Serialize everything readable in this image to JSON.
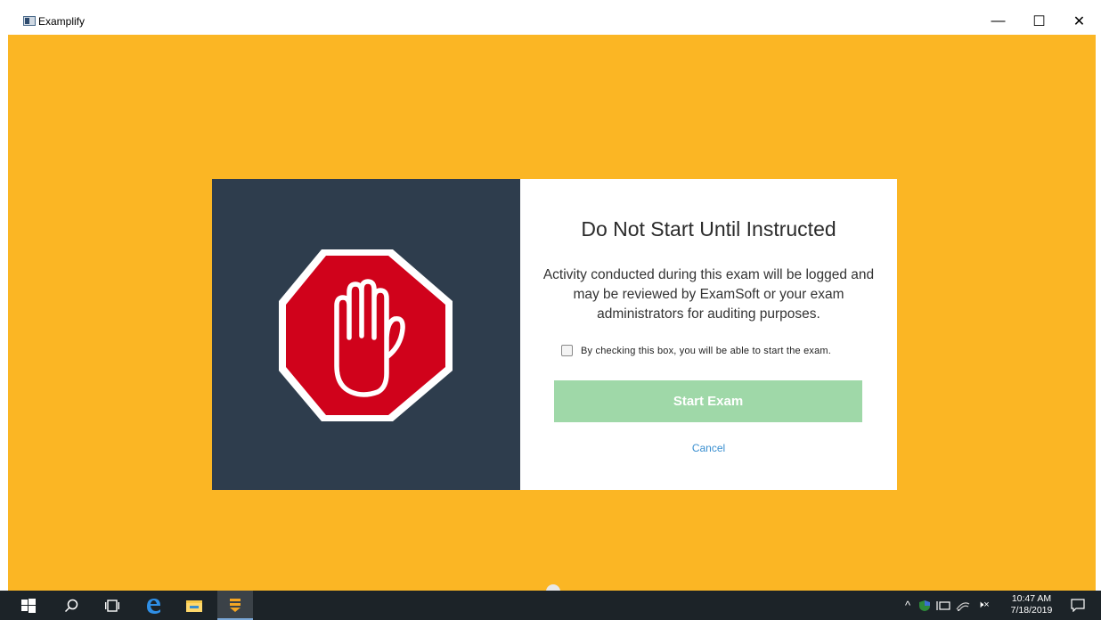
{
  "window": {
    "title": "Examplify",
    "minimize_glyph": "—",
    "maximize_glyph": "☐",
    "close_glyph": "✕"
  },
  "dialog": {
    "title": "Do Not Start Until Instructed",
    "body": "Activity conducted during this exam will be logged and may be reviewed by ExamSoft or your exam administrators for auditing purposes.",
    "checkbox_label": "By checking this box, you will be able to start the exam.",
    "checkbox_checked": false,
    "start_button": "Start Exam",
    "start_enabled": false,
    "cancel_link": "Cancel",
    "illustration_icon": "stop-hand-icon"
  },
  "colors": {
    "background": "#fbb624",
    "panel_dark": "#2e3d4d",
    "stop_red": "#d0021b",
    "start_button_disabled": "#9fd8a8",
    "link": "#3a8fd0"
  },
  "taskbar": {
    "icons": [
      "windows-start-icon",
      "search-icon",
      "task-view-icon",
      "edge-icon",
      "file-explorer-icon",
      "examplify-icon"
    ],
    "tray_icons": [
      "chevron-up-icon",
      "security-icon",
      "network-icon",
      "wifi-icon",
      "volume-muted-icon"
    ],
    "tray_chevron": "^",
    "volume_glyph": "🕨×",
    "time": "10:47 AM",
    "date": "7/18/2019",
    "notification_icon": "notification-icon"
  }
}
